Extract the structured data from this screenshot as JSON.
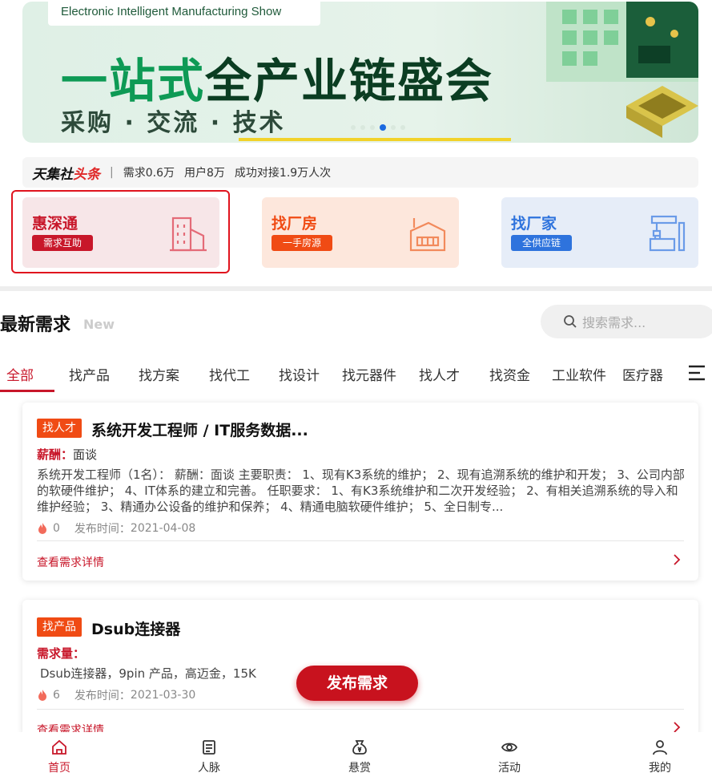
{
  "banner": {
    "tag": "Electronic Intelligent Manufacturing Show",
    "headline_green": "一站式",
    "headline_dark": "全产业链盛会",
    "subline": "采购 · 交流 · 技术",
    "slides": 6,
    "active_slide": 3
  },
  "stats": {
    "brand_dark": "天集社",
    "brand_red": "头条",
    "separator": "|",
    "demand": "需求0.6万",
    "users": "用户8万",
    "matched": "成功对接1.9万人次"
  },
  "categories": [
    {
      "title": "惠深通",
      "pill": "需求互助",
      "icon": "building-icon"
    },
    {
      "title": "找厂房",
      "pill": "一手房源",
      "icon": "factory-icon"
    },
    {
      "title": "找厂家",
      "pill": "全供应链",
      "icon": "robot-arm-icon"
    }
  ],
  "latest": {
    "title": "最新需求",
    "subtitle": "New"
  },
  "search": {
    "placeholder": "搜索需求..."
  },
  "tabs": [
    "全部",
    "找产品",
    "找方案",
    "找代工",
    "找设计",
    "找元器件",
    "找人才",
    "找资金",
    "工业软件",
    "医疗器"
  ],
  "cards": [
    {
      "badge": "找人才",
      "title": "系统开发工程师 / IT服务数据...",
      "field_label": "薪酬",
      "field_value": "面谈",
      "description": "系统开发工程师（1名）： 薪酬：面谈 主要职责： 1、现有K3系统的维护； 2、现有追溯系统的维护和开发； 3、公司内部的软硬件维护； 4、IT体系的建立和完善。 任职要求： 1、有K3系统维护和二次开发经验； 2、有相关追溯系统的导入和维护经验； 3、精通办公设备的维护和保养； 4、精通电脑软硬件维护； 5、全日制专...",
      "hot": "0",
      "date_label": "发布时间：",
      "date": "2021-04-08",
      "more": "查看需求详情"
    },
    {
      "badge": "找产品",
      "title": "Dsub连接器",
      "field_label": "需求量",
      "field_value": "",
      "description": "Dsub连接器，9pin 产品，高迈金，15K",
      "hot": "6",
      "date_label": "发布时间：",
      "date": "2021-03-30",
      "more": "查看需求详情"
    }
  ],
  "publish_button": "发布需求",
  "bottom_nav": [
    {
      "label": "首页",
      "icon": "home-icon"
    },
    {
      "label": "人脉",
      "icon": "contacts-icon"
    },
    {
      "label": "悬赏",
      "icon": "reward-bag-icon"
    },
    {
      "label": "活动",
      "icon": "eye-icon"
    },
    {
      "label": "我的",
      "icon": "user-icon"
    }
  ],
  "colors": {
    "accent": "#c8172a",
    "orange": "#f04b14",
    "blue": "#2e73dd",
    "green": "#0e9a55"
  }
}
